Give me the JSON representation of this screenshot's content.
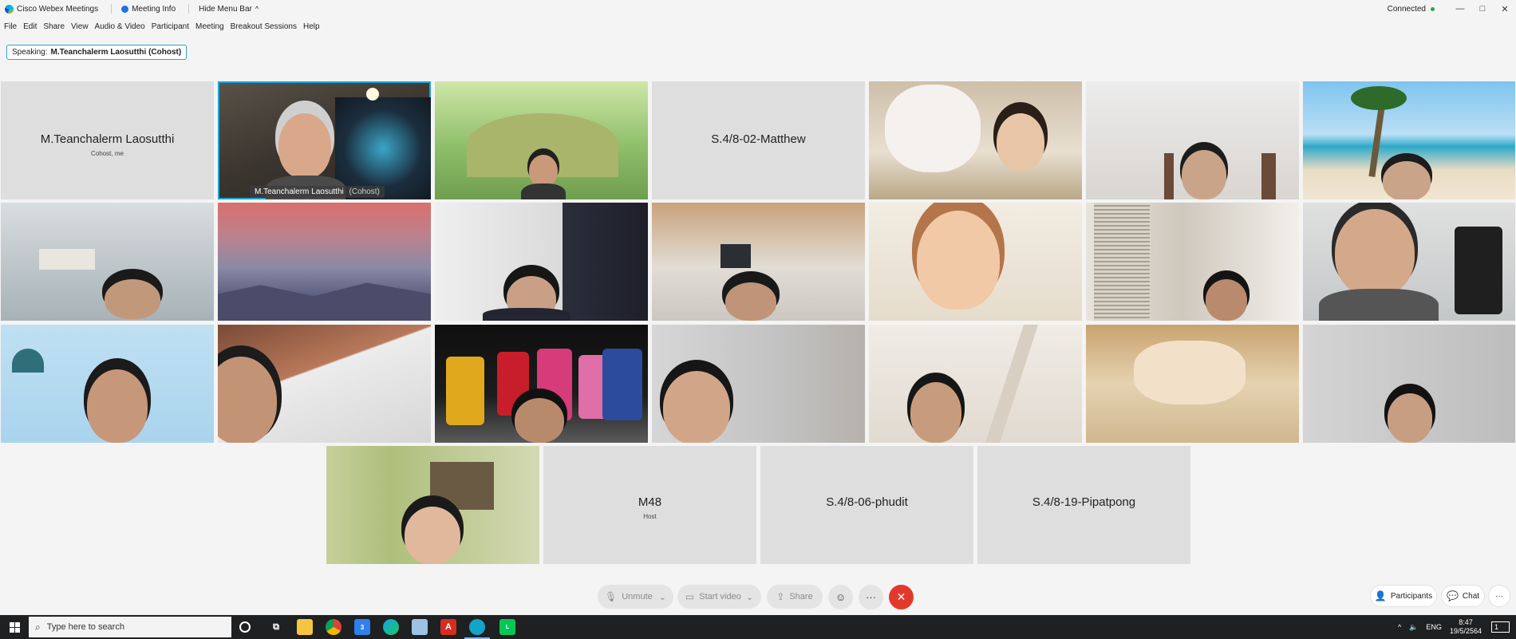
{
  "titlebar": {
    "app_title": "Cisco Webex Meetings",
    "meeting_info": "Meeting Info",
    "hide_menu_bar": "Hide Menu Bar",
    "hide_caret": "^",
    "connection_status": "Connected",
    "minimize_glyph": "—",
    "maximize_glyph": "□",
    "close_glyph": "✕"
  },
  "menubar": {
    "items": [
      "File",
      "Edit",
      "Share",
      "View",
      "Audio & Video",
      "Participant",
      "Meeting",
      "Breakout Sessions",
      "Help"
    ]
  },
  "speaking": {
    "label": "Speaking:",
    "name": "M.Teanchalerm Laosutthi (Cohost)"
  },
  "grid": {
    "name_only": [
      {
        "name": "M.Teanchalerm Laosutthi",
        "subtitle": "Cohost, me"
      },
      {
        "name": "S.4/8-02-Matthew",
        "subtitle": ""
      },
      {
        "name": "M48",
        "subtitle": "Host"
      },
      {
        "name": "S.4/8-06-phudit",
        "subtitle": ""
      },
      {
        "name": "S.4/8-19-Pipatpong",
        "subtitle": ""
      }
    ],
    "active_video": {
      "name": "M.Teanchalerm Laosutthi",
      "role": "(Cohost)"
    }
  },
  "controls": {
    "unmute": "Unmute",
    "start_video": "Start video",
    "share": "Share",
    "chevron": "⌄",
    "reactions_glyph": "☺",
    "more_glyph": "···",
    "end_glyph": "✕",
    "participants": "Participants",
    "chat": "Chat"
  },
  "taskbar": {
    "search_placeholder": "Type here to search",
    "language": "ENG",
    "time": "8:47",
    "date": "19/5/2564",
    "mail_badge": "3",
    "notification_count": "1"
  },
  "colors": {
    "accent_blue": "#16a6d8",
    "end_red": "#e3392c",
    "tile_gray": "#dcdcdc",
    "taskbar": "#1f2021"
  }
}
